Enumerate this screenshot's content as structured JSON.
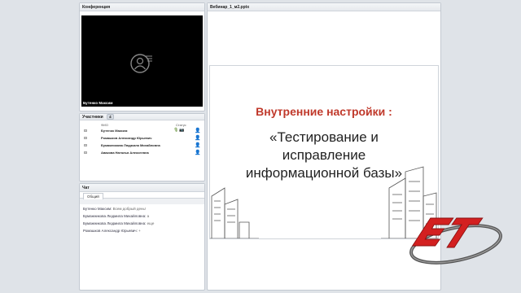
{
  "conference": {
    "title": "Конференция",
    "video_user": "Бутенко Максим"
  },
  "participants": {
    "title": "Участники",
    "count": "4",
    "col_name": "ФИО",
    "col_status": "Статус",
    "rows": [
      {
        "name": "Бутенко Максим"
      },
      {
        "name": "Ромашков Александр Юрьевич"
      },
      {
        "name": "Бумажникова Людмила Михайловна"
      },
      {
        "name": "Авакова Наталья Алексеевна"
      }
    ]
  },
  "chat": {
    "title": "Чат",
    "tab": "Общий",
    "messages": [
      {
        "author": "Бутенко Максим:",
        "text": "Всем добрый день!"
      },
      {
        "author": "Бумажникова Людмила Михайловна:",
        "text": "а"
      },
      {
        "author": "Бумажникова Людмила Михайловна:",
        "text": "еще"
      },
      {
        "author": "Ромашков Александр Юрьевич:",
        "text": "+"
      }
    ]
  },
  "presentation": {
    "title": "Вебинар_1_м2.pptx",
    "slide_title": "Внутренние настройки :",
    "slide_line1": "«Тестирование и",
    "slide_line2": "исправление",
    "slide_line3": "информационной базы»"
  },
  "colors": {
    "slide_title": "#c0392b",
    "logo_red": "#d32020"
  }
}
